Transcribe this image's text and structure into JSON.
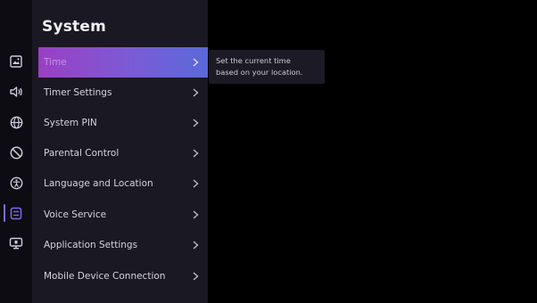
{
  "panel": {
    "title": "System"
  },
  "menu": [
    {
      "label": "Time",
      "selected": true
    },
    {
      "label": "Timer Settings"
    },
    {
      "label": "System PIN"
    },
    {
      "label": "Parental Control"
    },
    {
      "label": "Language and Location"
    },
    {
      "label": "Voice Service"
    },
    {
      "label": "Application Settings"
    },
    {
      "label": "Mobile Device Connection"
    }
  ],
  "tooltip": {
    "line1": "Set the current time",
    "line2": "based on your location."
  },
  "rail_icons": [
    {
      "name": "picture-icon"
    },
    {
      "name": "sound-icon"
    },
    {
      "name": "network-globe-icon"
    },
    {
      "name": "block-icon"
    },
    {
      "name": "accessibility-icon"
    },
    {
      "name": "system-icon",
      "active": true
    },
    {
      "name": "screen-cast-icon"
    }
  ],
  "colors": {
    "background": "#000000",
    "rail": "#0e0c13",
    "panel": "#1a1823",
    "selection_start": "#9b3fc4",
    "selection_end": "#5a69d9",
    "active_icon": "#7b6bf0"
  }
}
